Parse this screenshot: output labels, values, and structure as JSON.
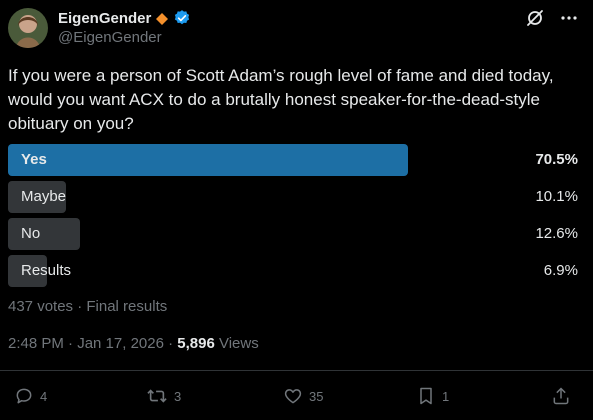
{
  "author": {
    "display_name": "EigenGender",
    "handle": "@EigenGender"
  },
  "tweet": {
    "text": "If you were a person of Scott Adam’s rough level of fame and died today, would you want ACX to do a brutally honest speaker-for-the-dead-style obituary on you?"
  },
  "poll": {
    "options": [
      {
        "label": "Yes",
        "percent": "70.5%",
        "fraction": 0.705,
        "winner": true
      },
      {
        "label": "Maybe",
        "percent": "10.1%",
        "fraction": 0.101,
        "winner": false
      },
      {
        "label": "No",
        "percent": "12.6%",
        "fraction": 0.126,
        "winner": false
      },
      {
        "label": "Results",
        "percent": "6.9%",
        "fraction": 0.069,
        "winner": false
      }
    ],
    "footer": "437 votes · Final results"
  },
  "meta": {
    "time": "2:48 PM · Jan 17, 2026 · ",
    "views_count": "5,896",
    "views_label": " Views"
  },
  "actions": {
    "replies": "4",
    "reposts": "3",
    "likes": "35",
    "bookmarks": "1"
  },
  "colors": {
    "accent": "#1d9bf0",
    "winner_bar": "#1d6fa5",
    "bar": "#333639",
    "badge_orange": "#f4902c"
  }
}
